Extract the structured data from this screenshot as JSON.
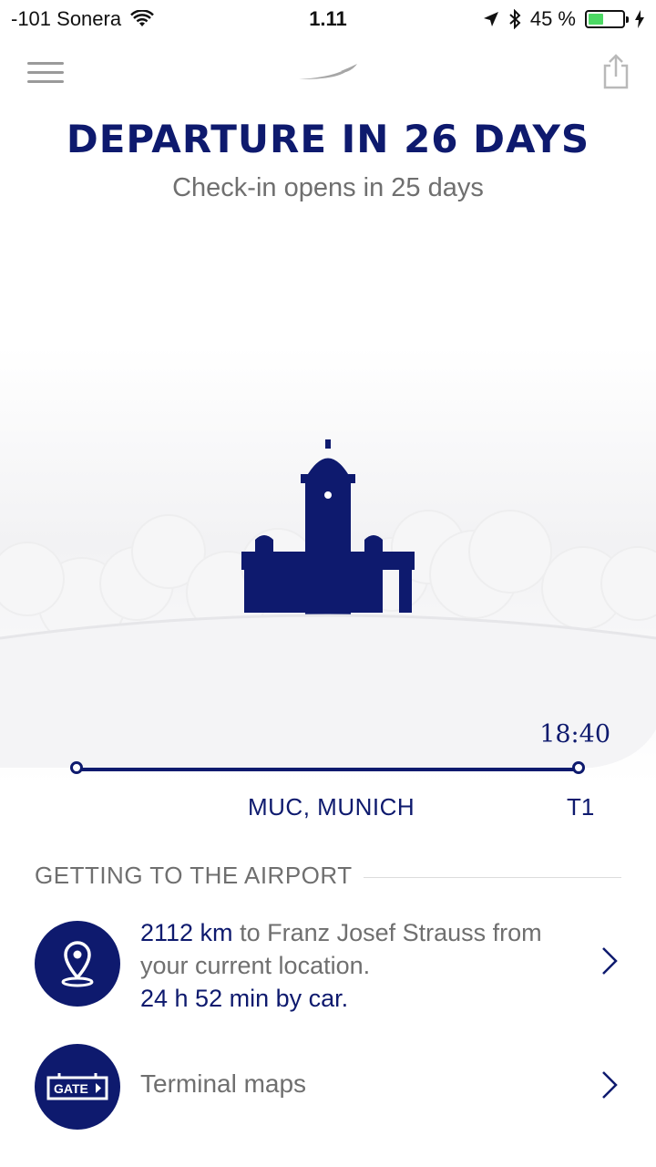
{
  "status_bar": {
    "carrier": "-101 Sonera",
    "time": "1.11",
    "battery_percent": "45 %",
    "battery_level": 0.45
  },
  "header": {
    "title": "DEPARTURE IN 26 DAYS",
    "subtitle": "Check-in opens in 25 days"
  },
  "flight": {
    "departure_time": "18:40",
    "airport": "MUC, MUNICH",
    "terminal": "T1"
  },
  "getting_to_airport": {
    "section_label": "GETTING TO THE AIRPORT",
    "distance_value": "2112 km",
    "distance_rest_1": " to Franz Josef Strauss from your current location.",
    "duration": "24 h 52 min by car.",
    "gate_badge": "GATE",
    "terminal_maps_label": "Terminal maps"
  },
  "icons": {
    "menu": "hamburger-icon",
    "logo": "airline-logo",
    "share": "share-icon",
    "location": "location-pin-icon",
    "gate": "gate-sign-icon",
    "chevron": "chevron-right-icon"
  },
  "colors": {
    "brand_navy": "#0e1a6e",
    "text_gray": "#6f6f6f",
    "battery_green": "#4cd964"
  }
}
